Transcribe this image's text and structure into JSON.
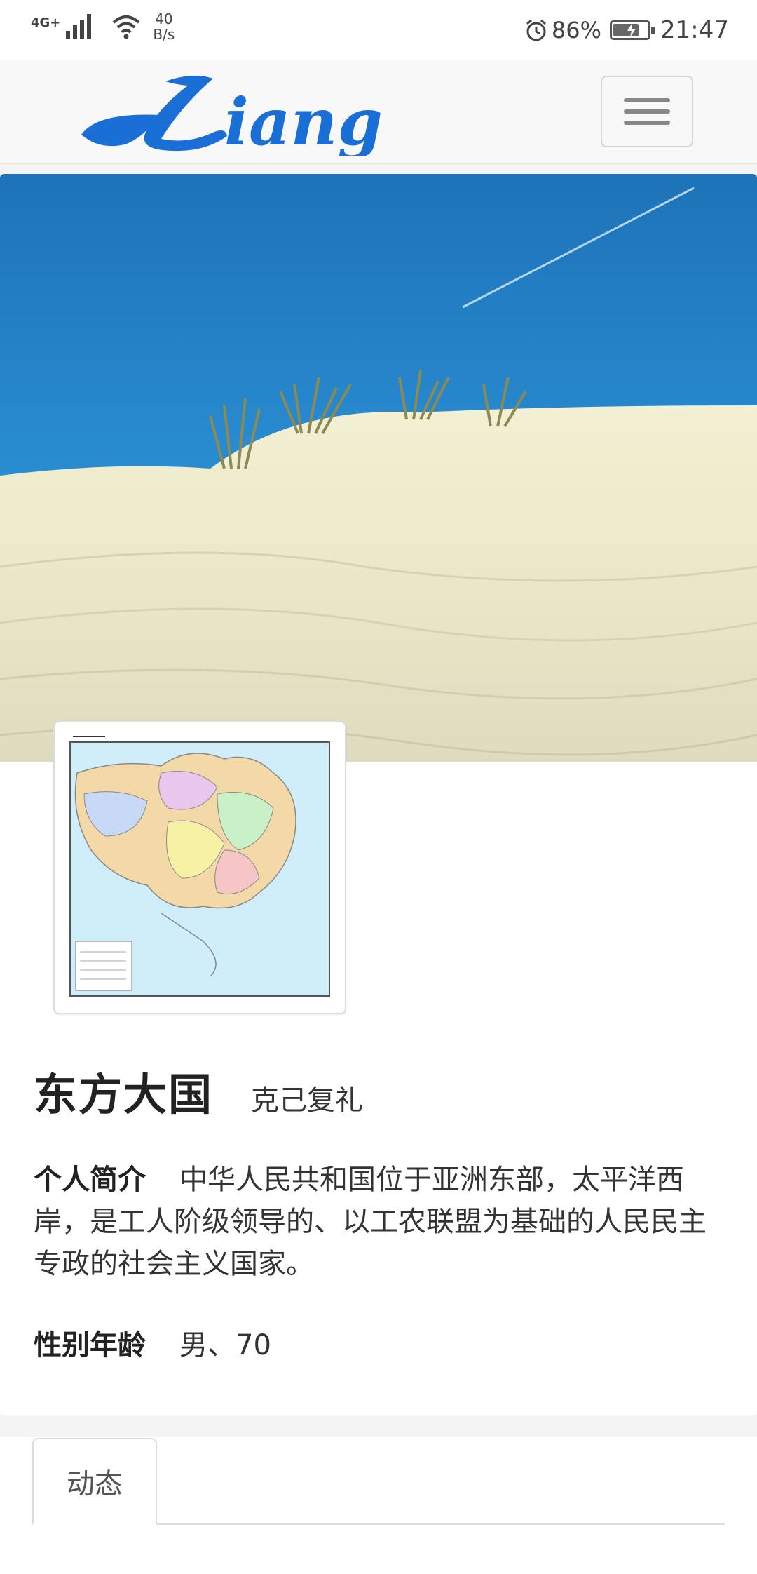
{
  "status_bar": {
    "network": "4G+",
    "speed_value": "40",
    "speed_unit": "B/s",
    "battery": "86%",
    "time": "21:47"
  },
  "navbar": {
    "brand": "Liang",
    "brand_color": "#1a6fd6"
  },
  "profile": {
    "cover_icon": "desert-dune-photo",
    "avatar_icon": "china-map-image",
    "name": "东方大国",
    "motto": "克己复礼",
    "bio_label": "个人简介",
    "bio_text": "中华人民共和国位于亚洲东部，太平洋西岸，是工人阶级领导的、以工农联盟为基础的人民民主专政的社会主义国家。",
    "gender_age_label": "性别年龄",
    "gender_age_value": "男、70"
  },
  "tabs": [
    {
      "label": "动态"
    }
  ]
}
